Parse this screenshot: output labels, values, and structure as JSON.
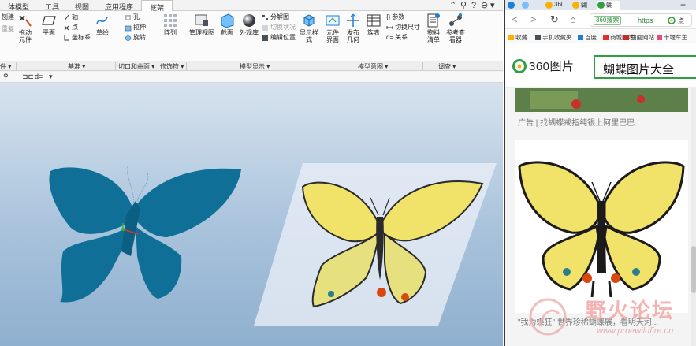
{
  "cad": {
    "menu_tabs": [
      "体模型",
      "工具",
      "视图",
      "应用程序",
      "框架"
    ],
    "window_controls": [
      "⌃",
      "⚲",
      "?",
      "⊖",
      "▾",
      "✕"
    ],
    "ribbon": {
      "left_partial": [
        "刨建",
        "重复"
      ],
      "drag": "拖动\n元件",
      "plane": "平面",
      "axis": "轴",
      "point": "点",
      "csys": "坐标系",
      "sketch": "草绘",
      "hole": "孔",
      "extrude": "拉伸",
      "revolve": "旋转",
      "pattern": "阵列",
      "manage_views": "管理视图",
      "section": "截面",
      "appearance": "外观库",
      "exploded": "分解图",
      "toggle_status": "切换状况",
      "edit_position": "编辑位置",
      "display_style": "显示样\n式",
      "component_interface": "元件\n界面",
      "publish_geometry": "发布\n几何",
      "family_table": "族表",
      "parameters": "参数",
      "switch_dimensions": "切换尺寸",
      "relations": "关系",
      "bom": "物料\n清单",
      "reference_viewer": "参考查\n看器"
    },
    "groups": [
      "件 ▾",
      "基准 ▾",
      "切口和曲面 ▾",
      "修饰符 ▾",
      "模型显示 ▾",
      "模型意图 ▾",
      "调查 ▾"
    ],
    "quick_toolbar": [
      "⚲",
      "⊐⊏",
      "d=",
      "▾"
    ]
  },
  "browser": {
    "tabs": [
      "",
      "",
      "360",
      "蝴",
      "蝴"
    ],
    "new_tab": "+",
    "nav": {
      "back": "<",
      "forward": ">",
      "reload": "↻",
      "home": "⌂"
    },
    "url_badge": "360搜索",
    "url_text": "https",
    "search_suggest": "点",
    "bookmarks": [
      "收藏",
      "手机收藏夹",
      "百度",
      "商城网站",
      "曲面网站",
      "十堰车主"
    ],
    "logo_text": "360图片",
    "search_query": "蝴蝶图片大全",
    "ad_text": "广告 | 找蝴蝶戒指纯银上阿里巴巴",
    "caption": "\"我为蝶狂\" 世界珍稀蝴蝶展，看明天河..."
  },
  "watermark": {
    "text": "野火论坛",
    "url": "www.proewildfire.cn"
  },
  "colors": {
    "brand_green": "#2f9e44",
    "cad_model": "#0f6f96",
    "viewport_top": "#d7e3ee",
    "viewport_bottom": "#8fb0cf",
    "butterfly_yellow": "#f1e26a"
  }
}
